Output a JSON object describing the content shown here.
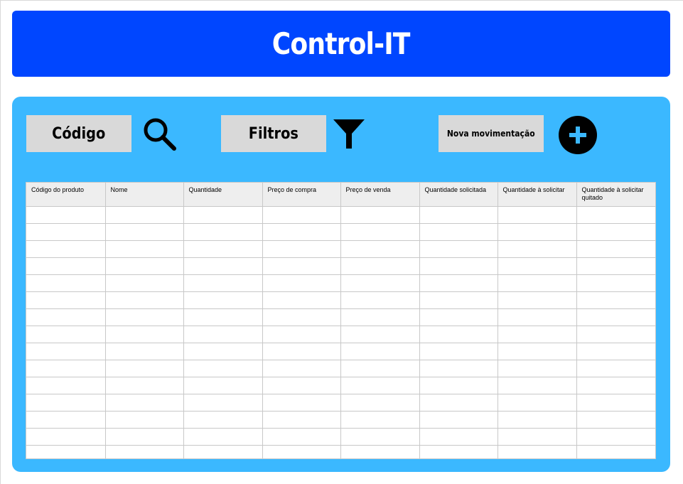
{
  "app": {
    "title": "Control-IT"
  },
  "toolbar": {
    "codigo_label": "Código",
    "filtros_label": "Filtros",
    "nova_label": "Nova movimentação",
    "icons": [
      "search-icon",
      "filter-icon",
      "add-icon"
    ]
  },
  "table": {
    "columns": [
      "Código do produto",
      "Nome",
      "Quantidade",
      "Preço de compra",
      "Preço de venda",
      "Quantidade solicitada",
      "Quantidade à solicitar",
      "Quantidade à solicitar quitado"
    ],
    "rows": [
      [
        "",
        "",
        "",
        "",
        "",
        "",
        "",
        ""
      ],
      [
        "",
        "",
        "",
        "",
        "",
        "",
        "",
        ""
      ],
      [
        "",
        "",
        "",
        "",
        "",
        "",
        "",
        ""
      ],
      [
        "",
        "",
        "",
        "",
        "",
        "",
        "",
        ""
      ],
      [
        "",
        "",
        "",
        "",
        "",
        "",
        "",
        ""
      ],
      [
        "",
        "",
        "",
        "",
        "",
        "",
        "",
        ""
      ],
      [
        "",
        "",
        "",
        "",
        "",
        "",
        "",
        ""
      ],
      [
        "",
        "",
        "",
        "",
        "",
        "",
        "",
        ""
      ],
      [
        "",
        "",
        "",
        "",
        "",
        "",
        "",
        ""
      ],
      [
        "",
        "",
        "",
        "",
        "",
        "",
        "",
        ""
      ],
      [
        "",
        "",
        "",
        "",
        "",
        "",
        "",
        ""
      ],
      [
        "",
        "",
        "",
        "",
        "",
        "",
        "",
        ""
      ],
      [
        "",
        "",
        "",
        "",
        "",
        "",
        "",
        ""
      ],
      [
        "",
        "",
        "",
        "",
        "",
        "",
        "",
        ""
      ],
      [
        "",
        "",
        "",
        "",
        "",
        "",
        "",
        ""
      ]
    ]
  },
  "colors": {
    "header_bg": "#0046ff",
    "panel_bg": "#3bb8ff",
    "button_bg": "#d9d9d9",
    "table_header_bg": "#eeeeee",
    "grid_line": "#c8c8c8"
  }
}
